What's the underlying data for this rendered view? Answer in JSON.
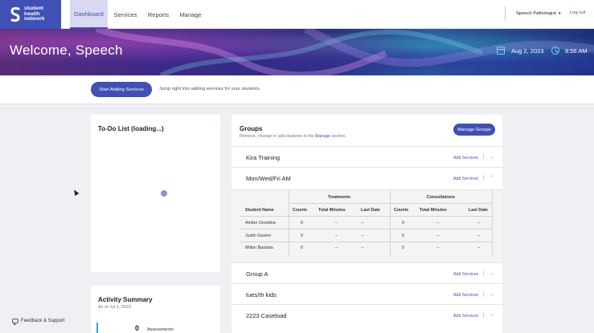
{
  "nav": {
    "logo_lines": [
      "student",
      "health",
      "network"
    ],
    "tabs": [
      {
        "label": "Dashboard",
        "active": true
      },
      {
        "label": "Services",
        "active": false
      },
      {
        "label": "Reports",
        "active": false
      },
      {
        "label": "Manage",
        "active": false
      }
    ],
    "role": "Speech Pathologist",
    "logout": "Log out"
  },
  "banner": {
    "welcome": "Welcome, Speech",
    "date": "Aug 2, 2023",
    "time": "8:56 AM"
  },
  "actions": {
    "start_label": "Start Adding Services",
    "hint": "Jump right into adding services for your students."
  },
  "todo": {
    "title": "To-Do List (loading...)"
  },
  "activity": {
    "title": "Activity Summary",
    "subtitle": "As of Jul 1, 2023",
    "count": "0",
    "count_label": "Assessments"
  },
  "groups": {
    "title": "Groups",
    "subtitle_pre": "Remove, change or add students in the ",
    "subtitle_link": "Manage",
    "subtitle_post": " section.",
    "manage_label": "Manage Groups",
    "add_label": "Add Services",
    "rows_top": [
      "Kira Training",
      "Mon/Wed/Fri AM"
    ],
    "rows_bottom": [
      "Group A",
      "tues/th kids",
      "2223 Caseload"
    ],
    "table": {
      "group_treatments": "Treatments",
      "group_consultations": "Consultations",
      "headers": [
        "Student Name",
        "Counts",
        "Total Minutes",
        "Last Date",
        "Counts",
        "Total Minutes",
        "Last Date"
      ],
      "rows": [
        [
          "Amber Dovalina",
          "0",
          "--",
          "--",
          "0",
          "--",
          "--"
        ],
        [
          "Justin Gavino",
          "0",
          "--",
          "--",
          "0",
          "--",
          "--"
        ],
        [
          "Milton Bautista",
          "0",
          "--",
          "--",
          "0",
          "--",
          "--"
        ]
      ]
    }
  },
  "footer": {
    "feedback": "Feedback & Support"
  },
  "colors": {
    "brand": "#3f51b5",
    "accent": "#2fa4e7"
  }
}
